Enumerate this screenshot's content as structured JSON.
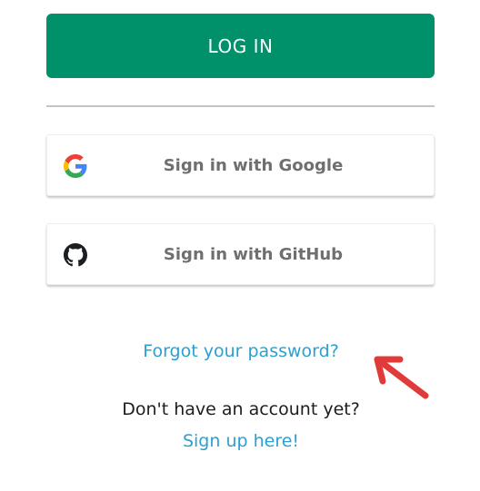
{
  "login": {
    "label": "LOG IN"
  },
  "social": {
    "google": {
      "label": "Sign in with Google",
      "icon": "google-icon"
    },
    "github": {
      "label": "Sign in with GitHub",
      "icon": "github-icon"
    }
  },
  "links": {
    "forgot_password": "Forgot your password?",
    "no_account": "Don't have an account yet?",
    "sign_up": "Sign up here!"
  },
  "colors": {
    "primary": "#00916a",
    "link": "#2c9fd1",
    "annotation": "#e03a3a"
  }
}
